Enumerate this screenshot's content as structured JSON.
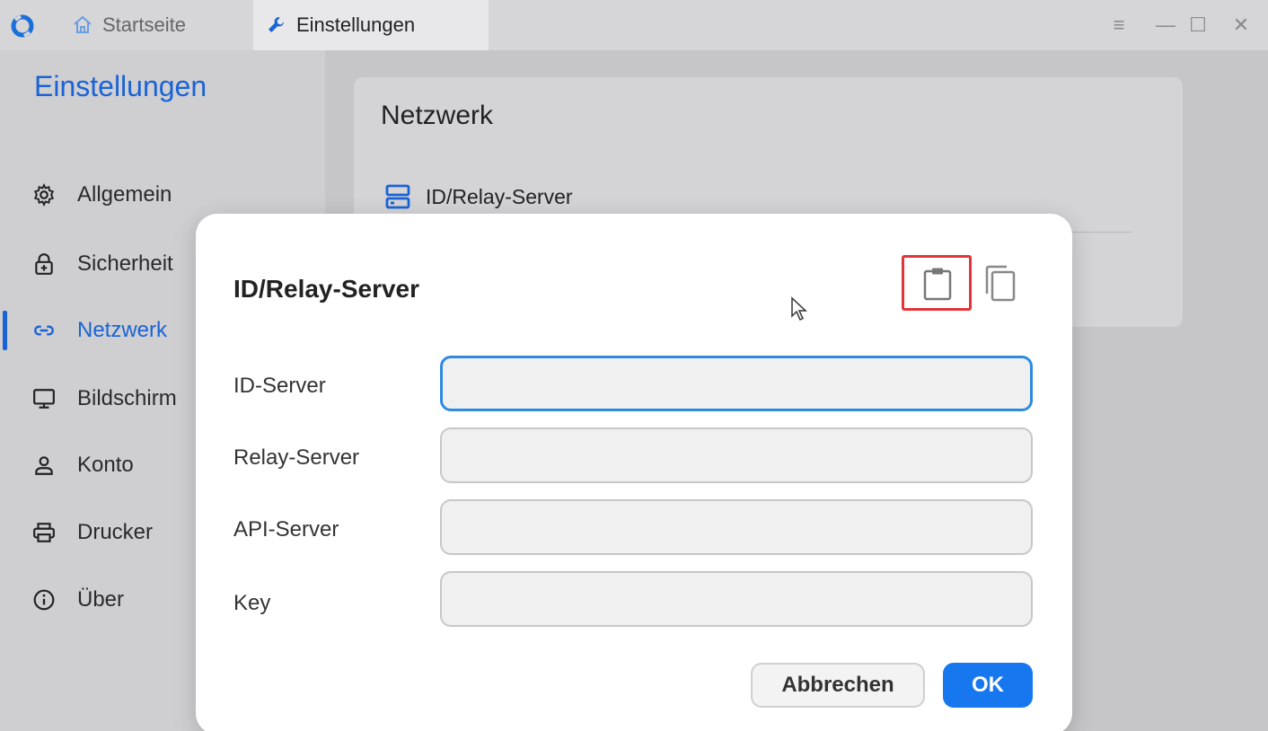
{
  "titlebar": {
    "tabs": [
      {
        "label": "Startseite",
        "icon": "home-icon"
      },
      {
        "label": "Einstellungen",
        "icon": "wrench-icon"
      }
    ],
    "controls": {
      "menu": "≡",
      "minimize": "—",
      "maximize": "☐",
      "close": "✕"
    }
  },
  "sidebar": {
    "title": "Einstellungen",
    "items": [
      {
        "label": "Allgemein",
        "icon": "gear-icon"
      },
      {
        "label": "Sicherheit",
        "icon": "lock-icon"
      },
      {
        "label": "Netzwerk",
        "icon": "link-icon",
        "active": true
      },
      {
        "label": "Bildschirm",
        "icon": "monitor-icon"
      },
      {
        "label": "Konto",
        "icon": "user-icon"
      },
      {
        "label": "Drucker",
        "icon": "printer-icon"
      },
      {
        "label": "Über",
        "icon": "info-icon"
      }
    ]
  },
  "main": {
    "card_title": "Netzwerk",
    "card_item": "ID/Relay-Server"
  },
  "dialog": {
    "title": "ID/Relay-Server",
    "fields": [
      {
        "label": "ID-Server",
        "value": ""
      },
      {
        "label": "Relay-Server",
        "value": ""
      },
      {
        "label": "API-Server",
        "value": ""
      },
      {
        "label": "Key",
        "value": ""
      }
    ],
    "cancel_label": "Abbrechen",
    "ok_label": "OK"
  },
  "colors": {
    "accent": "#1a63d6",
    "ok_button": "#1677ee",
    "highlight": "#e2353a",
    "focus_border": "#2e8be0"
  }
}
